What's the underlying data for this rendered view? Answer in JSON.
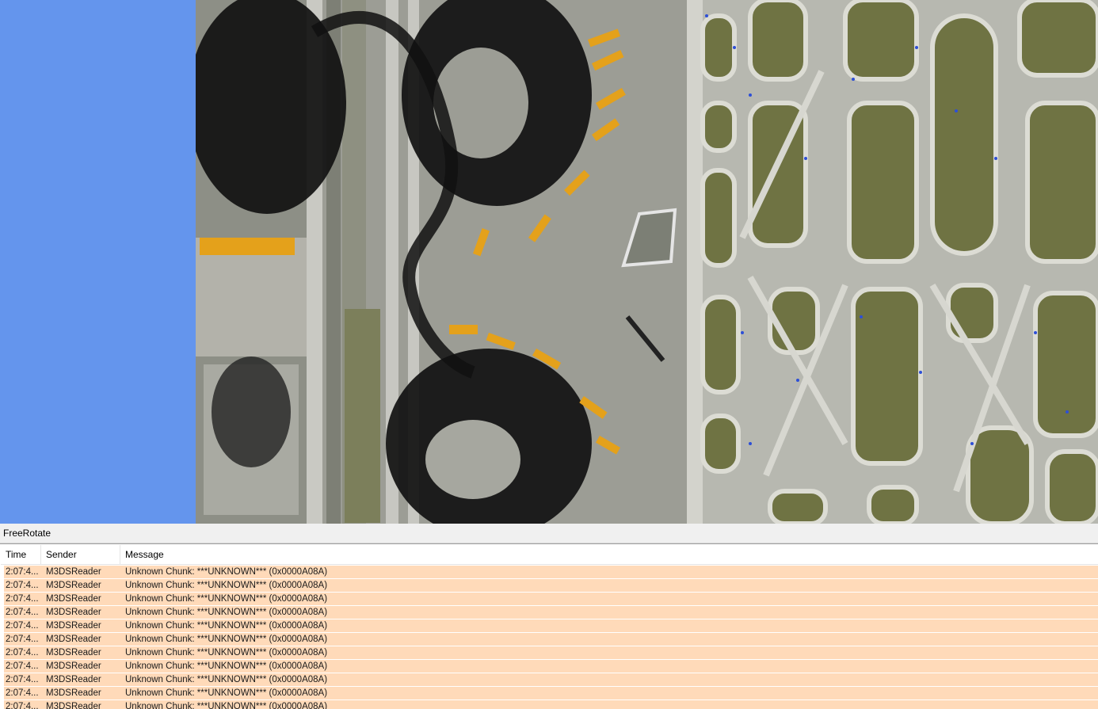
{
  "status": {
    "label": "FreeRotate"
  },
  "log": {
    "columns": {
      "time": "Time",
      "sender": "Sender",
      "message": "Message"
    },
    "rows": [
      {
        "time": "2:07:4...",
        "sender": "M3DSReader",
        "message": "Unknown Chunk: ***UNKNOWN*** (0x0000A08A)"
      },
      {
        "time": "2:07:4...",
        "sender": "M3DSReader",
        "message": "Unknown Chunk: ***UNKNOWN*** (0x0000A08A)"
      },
      {
        "time": "2:07:4...",
        "sender": "M3DSReader",
        "message": "Unknown Chunk: ***UNKNOWN*** (0x0000A08A)"
      },
      {
        "time": "2:07:4...",
        "sender": "M3DSReader",
        "message": "Unknown Chunk: ***UNKNOWN*** (0x0000A08A)"
      },
      {
        "time": "2:07:4...",
        "sender": "M3DSReader",
        "message": "Unknown Chunk: ***UNKNOWN*** (0x0000A08A)"
      },
      {
        "time": "2:07:4...",
        "sender": "M3DSReader",
        "message": "Unknown Chunk: ***UNKNOWN*** (0x0000A08A)"
      },
      {
        "time": "2:07:4...",
        "sender": "M3DSReader",
        "message": "Unknown Chunk: ***UNKNOWN*** (0x0000A08A)"
      },
      {
        "time": "2:07:4...",
        "sender": "M3DSReader",
        "message": "Unknown Chunk: ***UNKNOWN*** (0x0000A08A)"
      },
      {
        "time": "2:07:4...",
        "sender": "M3DSReader",
        "message": "Unknown Chunk: ***UNKNOWN*** (0x0000A08A)"
      },
      {
        "time": "2:07:4...",
        "sender": "M3DSReader",
        "message": "Unknown Chunk: ***UNKNOWN*** (0x0000A08A)"
      },
      {
        "time": "2:07:4...",
        "sender": "M3DSReader",
        "message": "Unknown Chunk: ***UNKNOWN*** (0x0000A08A)"
      }
    ]
  },
  "colors": {
    "viewport_background": "#6495ed",
    "log_row_background": "#ffdab9"
  }
}
